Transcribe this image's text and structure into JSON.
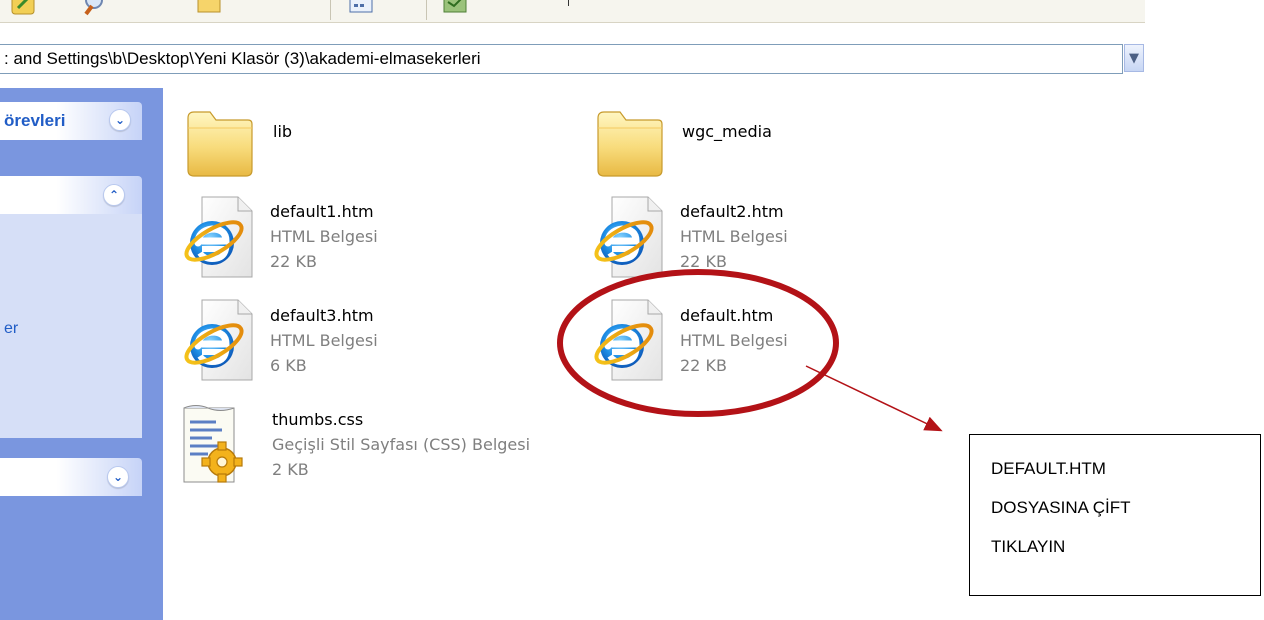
{
  "address_bar": {
    "path": ": and Settings\\b\\Desktop\\Yeni Klasör (3)\\akademi-elmasekerleri"
  },
  "task_pane": {
    "panel1_title": "örevleri",
    "partial_text": "er"
  },
  "files": [
    {
      "name": "lib",
      "kind": "folder"
    },
    {
      "name": "wgc_media",
      "kind": "folder"
    },
    {
      "name": "default1.htm",
      "type": "HTML Belgesi",
      "size": "22 KB",
      "kind": "html"
    },
    {
      "name": "default2.htm",
      "type": "HTML Belgesi",
      "size": "22 KB",
      "kind": "html"
    },
    {
      "name": "default3.htm",
      "type": "HTML Belgesi",
      "size": "6 KB",
      "kind": "html"
    },
    {
      "name": "default.htm",
      "type": "HTML Belgesi",
      "size": "22 KB",
      "kind": "html"
    },
    {
      "name": "thumbs.css",
      "type": "Geçişli Stil Sayfası (CSS) Belgesi",
      "size": "2 KB",
      "kind": "css"
    }
  ],
  "annotation": {
    "lines": [
      "DEFAULT.HTM",
      "DOSYASINA ÇİFT",
      "TIKLAYIN"
    ],
    "highlight_color": "#b31217",
    "arrow_color": "#b31217"
  },
  "icons": {
    "folder": "folder-icon",
    "html": "ie-html-document-icon",
    "css": "css-document-icon",
    "dropdown": "chevron-down-icon",
    "collapse": "chevron-up-double-icon",
    "expand": "chevron-down-double-icon"
  },
  "colors": {
    "task_pane_bg": "#7a96df",
    "task_pane_title": "#215dc6"
  }
}
